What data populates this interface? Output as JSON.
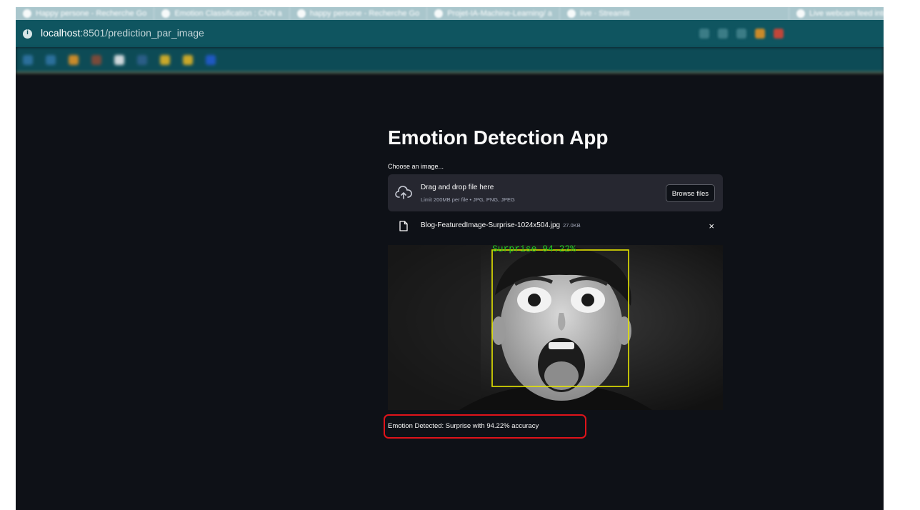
{
  "browser": {
    "tabs": [
      "Happy persone - Recherche Go",
      "Emotion Classification : CNN a",
      "happy persone - Recherche Go",
      "Projet-IA-Machine-Learning/ a",
      "live · Streamlit",
      "Live webcam feed into"
    ],
    "url_host": "localhost",
    "url_path": ":8501/prediction_par_image"
  },
  "app": {
    "title": "Emotion Detection App",
    "uploader": {
      "label": "Choose an image...",
      "drop_title": "Drag and drop file here",
      "limit_text": "Limit 200MB per file • JPG, PNG, JPEG",
      "browse_label": "Browse files",
      "icon": "cloud-upload-icon"
    },
    "file": {
      "name": "Blog-FeaturedImage-Surprise-1024x504.jpg",
      "size": "27.0KB",
      "icon": "file-icon",
      "remove_symbol": "×"
    },
    "image": {
      "overlay_label": "Surprise 94.22%",
      "box_color": "#e6e600",
      "label_color": "#22cc22"
    },
    "result_text": "Emotion Detected: Surprise with 94.22% accuracy"
  },
  "colors": {
    "background": "#0e1117",
    "surface": "#262730",
    "text": "#fafafa",
    "highlight": "#e0131a"
  }
}
